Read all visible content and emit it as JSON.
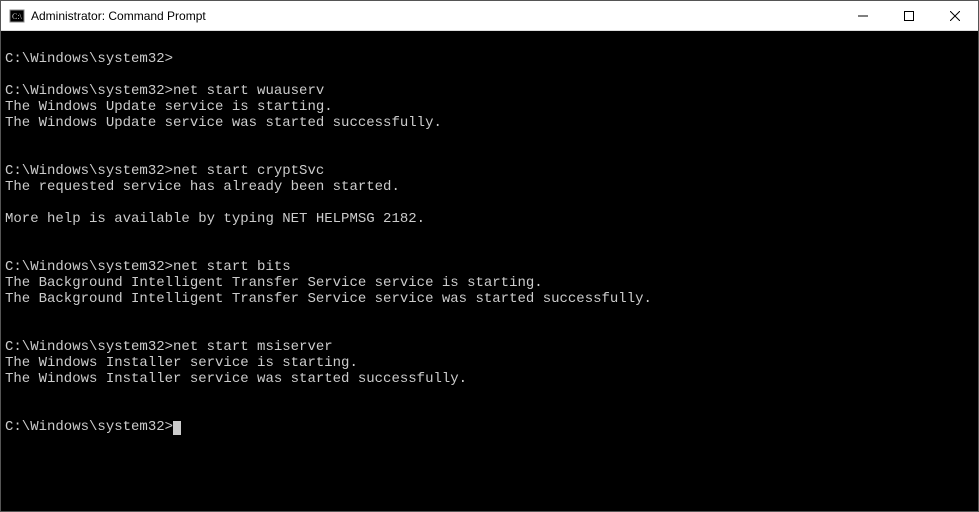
{
  "window": {
    "title": "Administrator: Command Prompt"
  },
  "prompt": "C:\\Windows\\system32>",
  "blocks": [
    {
      "type": "blank"
    },
    {
      "type": "promptline",
      "cmd": ""
    },
    {
      "type": "blank"
    },
    {
      "type": "promptline",
      "cmd": "net start wuauserv"
    },
    {
      "type": "output",
      "text": "The Windows Update service is starting."
    },
    {
      "type": "output",
      "text": "The Windows Update service was started successfully."
    },
    {
      "type": "blank"
    },
    {
      "type": "blank"
    },
    {
      "type": "promptline",
      "cmd": "net start cryptSvc"
    },
    {
      "type": "output",
      "text": "The requested service has already been started."
    },
    {
      "type": "blank"
    },
    {
      "type": "output",
      "text": "More help is available by typing NET HELPMSG 2182."
    },
    {
      "type": "blank"
    },
    {
      "type": "blank"
    },
    {
      "type": "promptline",
      "cmd": "net start bits"
    },
    {
      "type": "output",
      "text": "The Background Intelligent Transfer Service service is starting."
    },
    {
      "type": "output",
      "text": "The Background Intelligent Transfer Service service was started successfully."
    },
    {
      "type": "blank"
    },
    {
      "type": "blank"
    },
    {
      "type": "promptline",
      "cmd": "net start msiserver"
    },
    {
      "type": "output",
      "text": "The Windows Installer service is starting."
    },
    {
      "type": "output",
      "text": "The Windows Installer service was started successfully."
    },
    {
      "type": "blank"
    },
    {
      "type": "blank"
    },
    {
      "type": "promptcursor"
    }
  ]
}
